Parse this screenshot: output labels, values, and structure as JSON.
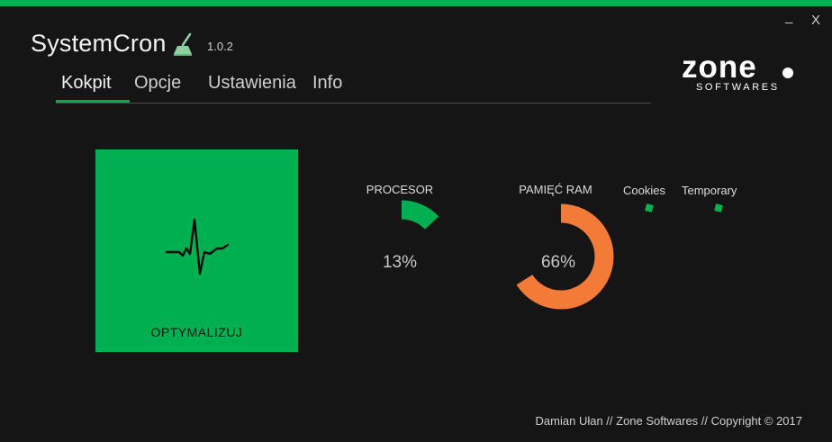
{
  "window": {
    "minimize_label": "_",
    "close_label": "X",
    "accent_color": "#00b050",
    "background_color": "#151515"
  },
  "app": {
    "title": "SystemCron",
    "version": "1.0.2",
    "title_icon": "broom-icon"
  },
  "tabs": [
    {
      "label": "Kokpit",
      "active": true
    },
    {
      "label": "Opcje",
      "active": false
    },
    {
      "label": "Ustawienia",
      "active": false
    },
    {
      "label": "Info",
      "active": false
    }
  ],
  "logo": {
    "wordmark": "zone",
    "subtitle": "SOFTWARES"
  },
  "optimize_button": {
    "label": "OPTYMALIZUJ",
    "icon": "heartbeat-icon",
    "color": "#00b050"
  },
  "gauges": {
    "cpu": {
      "title": "PROCESOR",
      "value_text": "13%",
      "percent": 13,
      "color": "#00b050"
    },
    "ram": {
      "title": "PAMIĘĆ RAM",
      "value_text": "66%",
      "percent": 66,
      "color": "#f47a38"
    }
  },
  "mini_indicators": [
    {
      "label": "Cookies",
      "color": "#00b050"
    },
    {
      "label": "Temporary",
      "color": "#00b050"
    }
  ],
  "footer": {
    "text": "Damian Ułan // Zone Softwares // Copyright © 2017"
  }
}
